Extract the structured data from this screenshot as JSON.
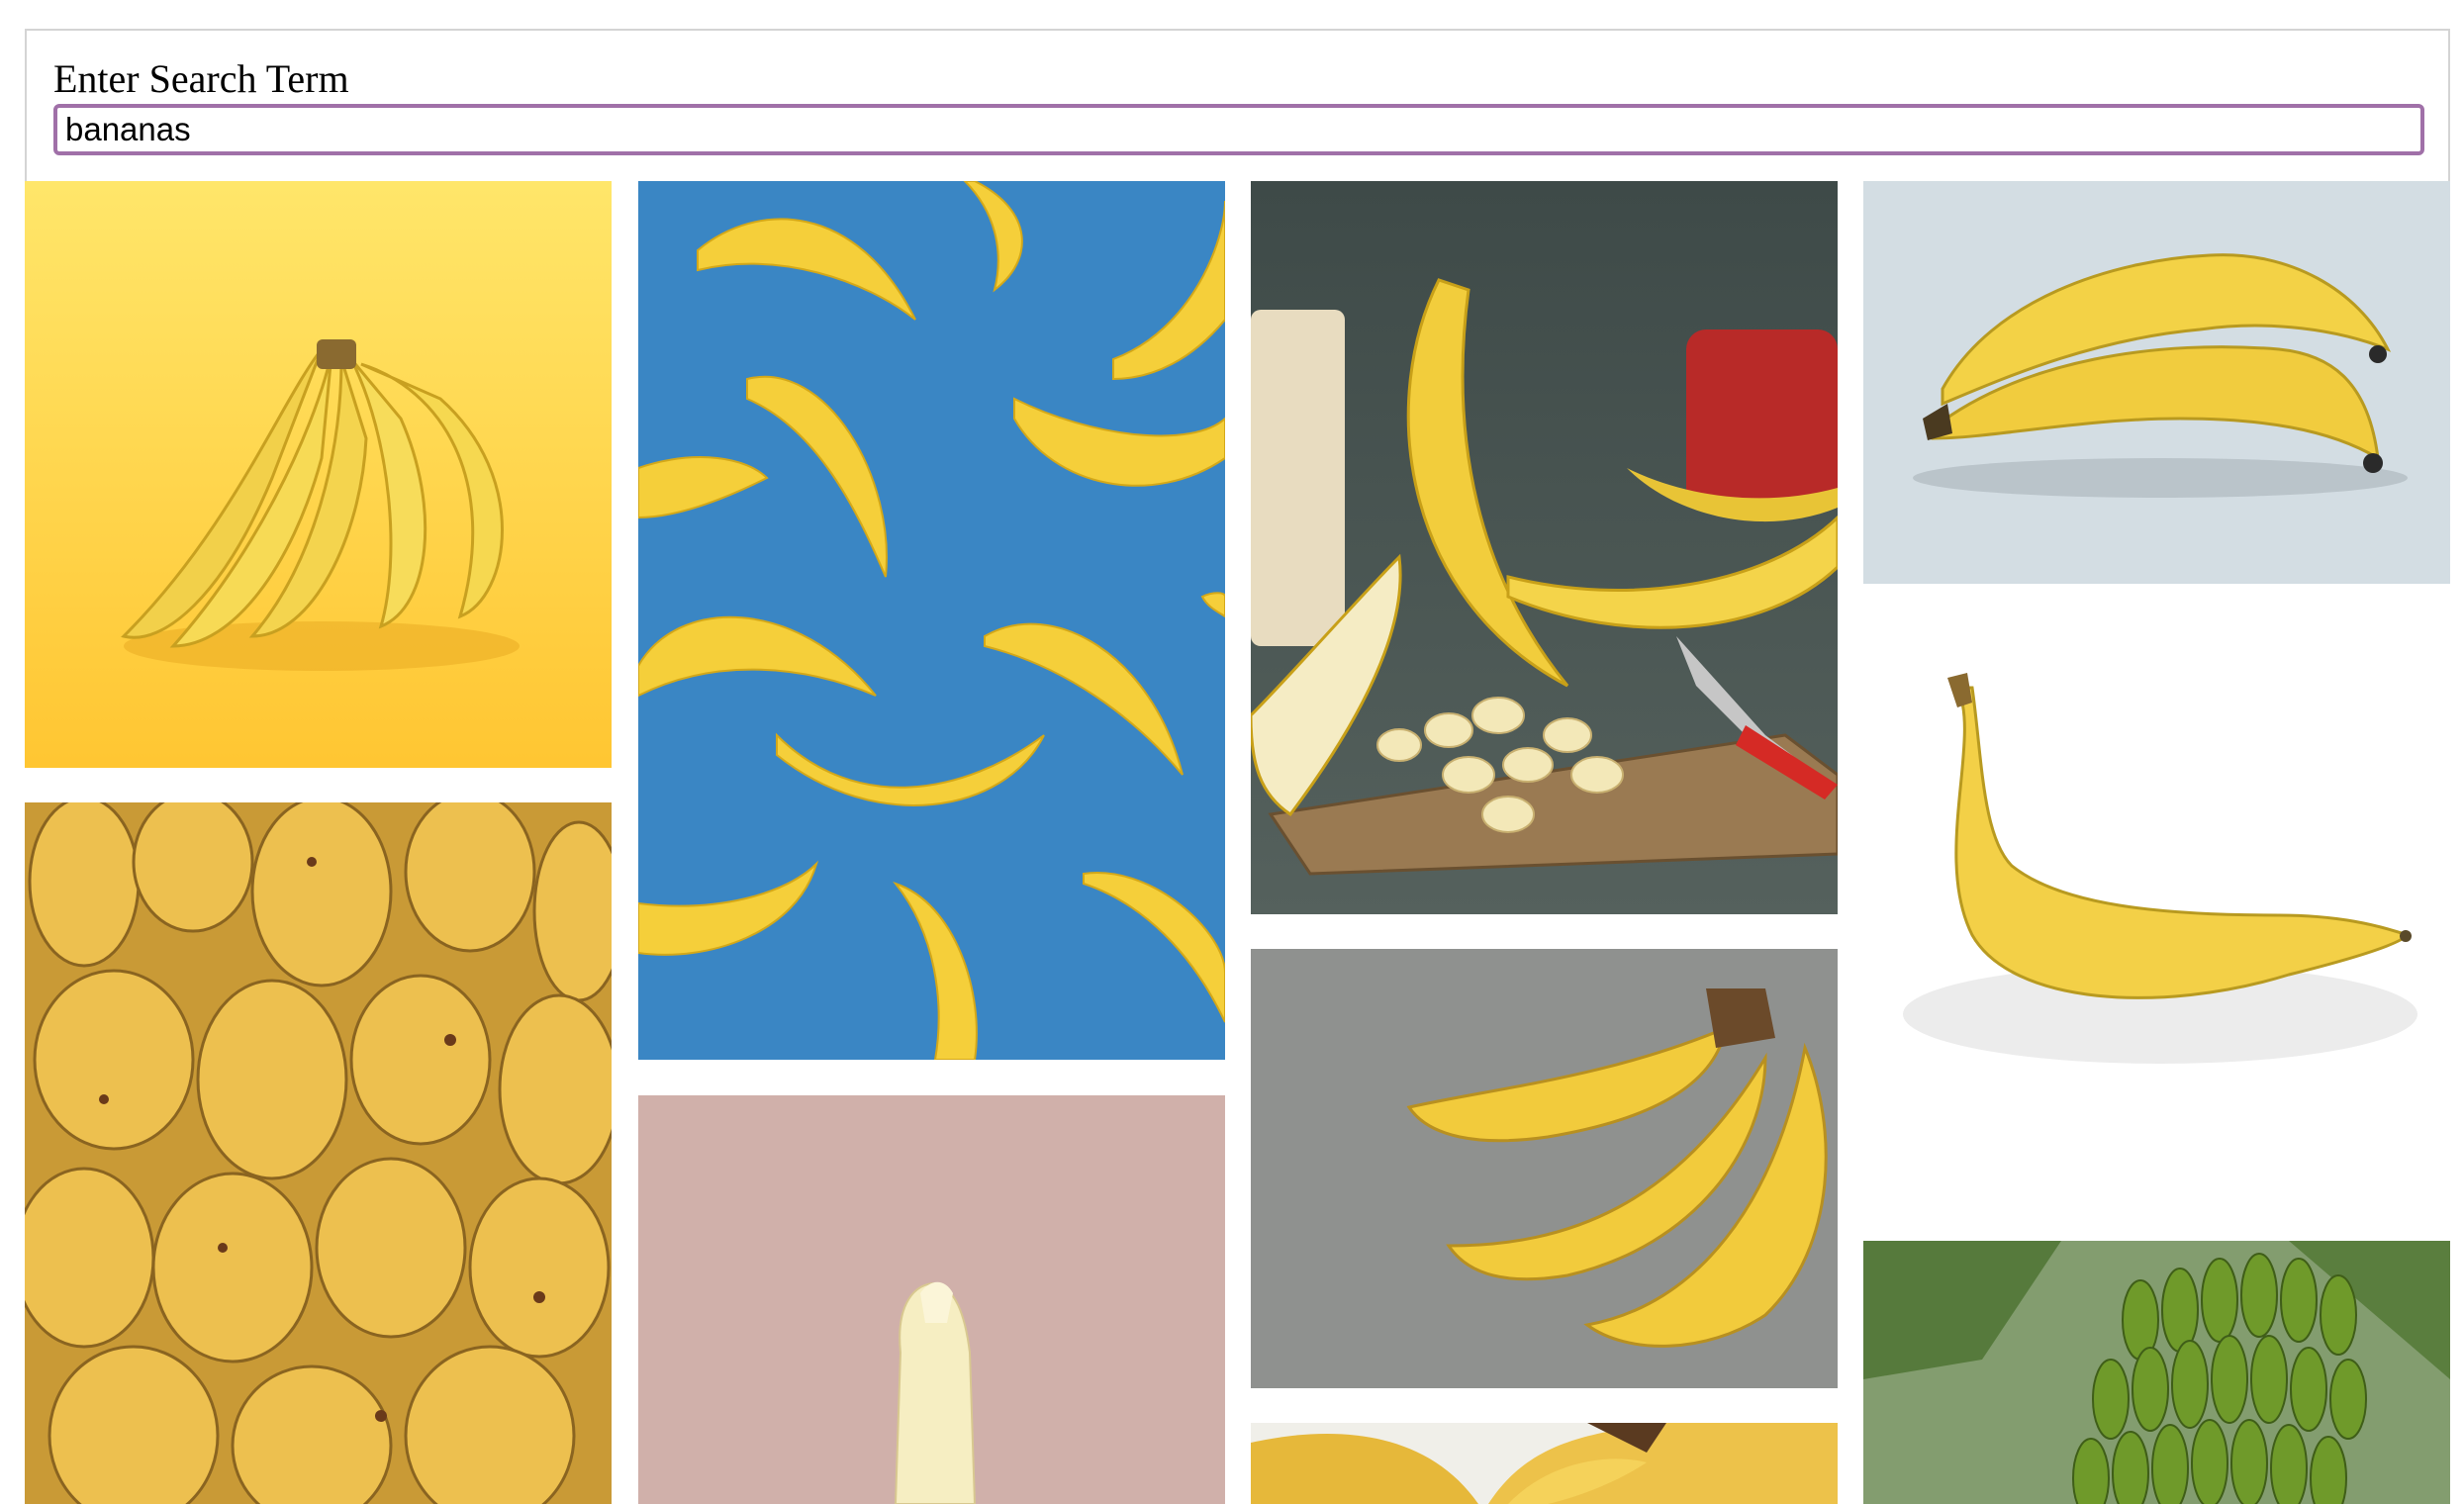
{
  "search": {
    "label": "Enter Search Term",
    "value": "bananas"
  },
  "gallery": {
    "columns": 4,
    "images": [
      {
        "name": "banana-bunch-yellow-background",
        "column": 1,
        "bg": "#ffd84a"
      },
      {
        "name": "many-banana-bunches-closeup",
        "column": 1,
        "bg": "#d9a83a"
      },
      {
        "name": "scattered-bananas-blue-background",
        "column": 2,
        "bg": "#3a86c4"
      },
      {
        "name": "peeled-banana-pink-background",
        "column": 2,
        "bg": "#d0b0aa"
      },
      {
        "name": "bananas-cutting-board-knife",
        "column": 3,
        "bg": "#46534f"
      },
      {
        "name": "banana-bunch-gray-surface",
        "column": 3,
        "bg": "#8e908e"
      },
      {
        "name": "bananas-partial-bottom",
        "column": 3,
        "bg": "#e6b83a"
      },
      {
        "name": "two-bananas-light-gray-background",
        "column": 4,
        "bg": "#d3dde3"
      },
      {
        "name": "single-banana-white-background",
        "column": 4,
        "bg": "#ffffff"
      },
      {
        "name": "green-bananas-on-tree",
        "column": 4,
        "bg": "#4f6e3a"
      }
    ]
  }
}
